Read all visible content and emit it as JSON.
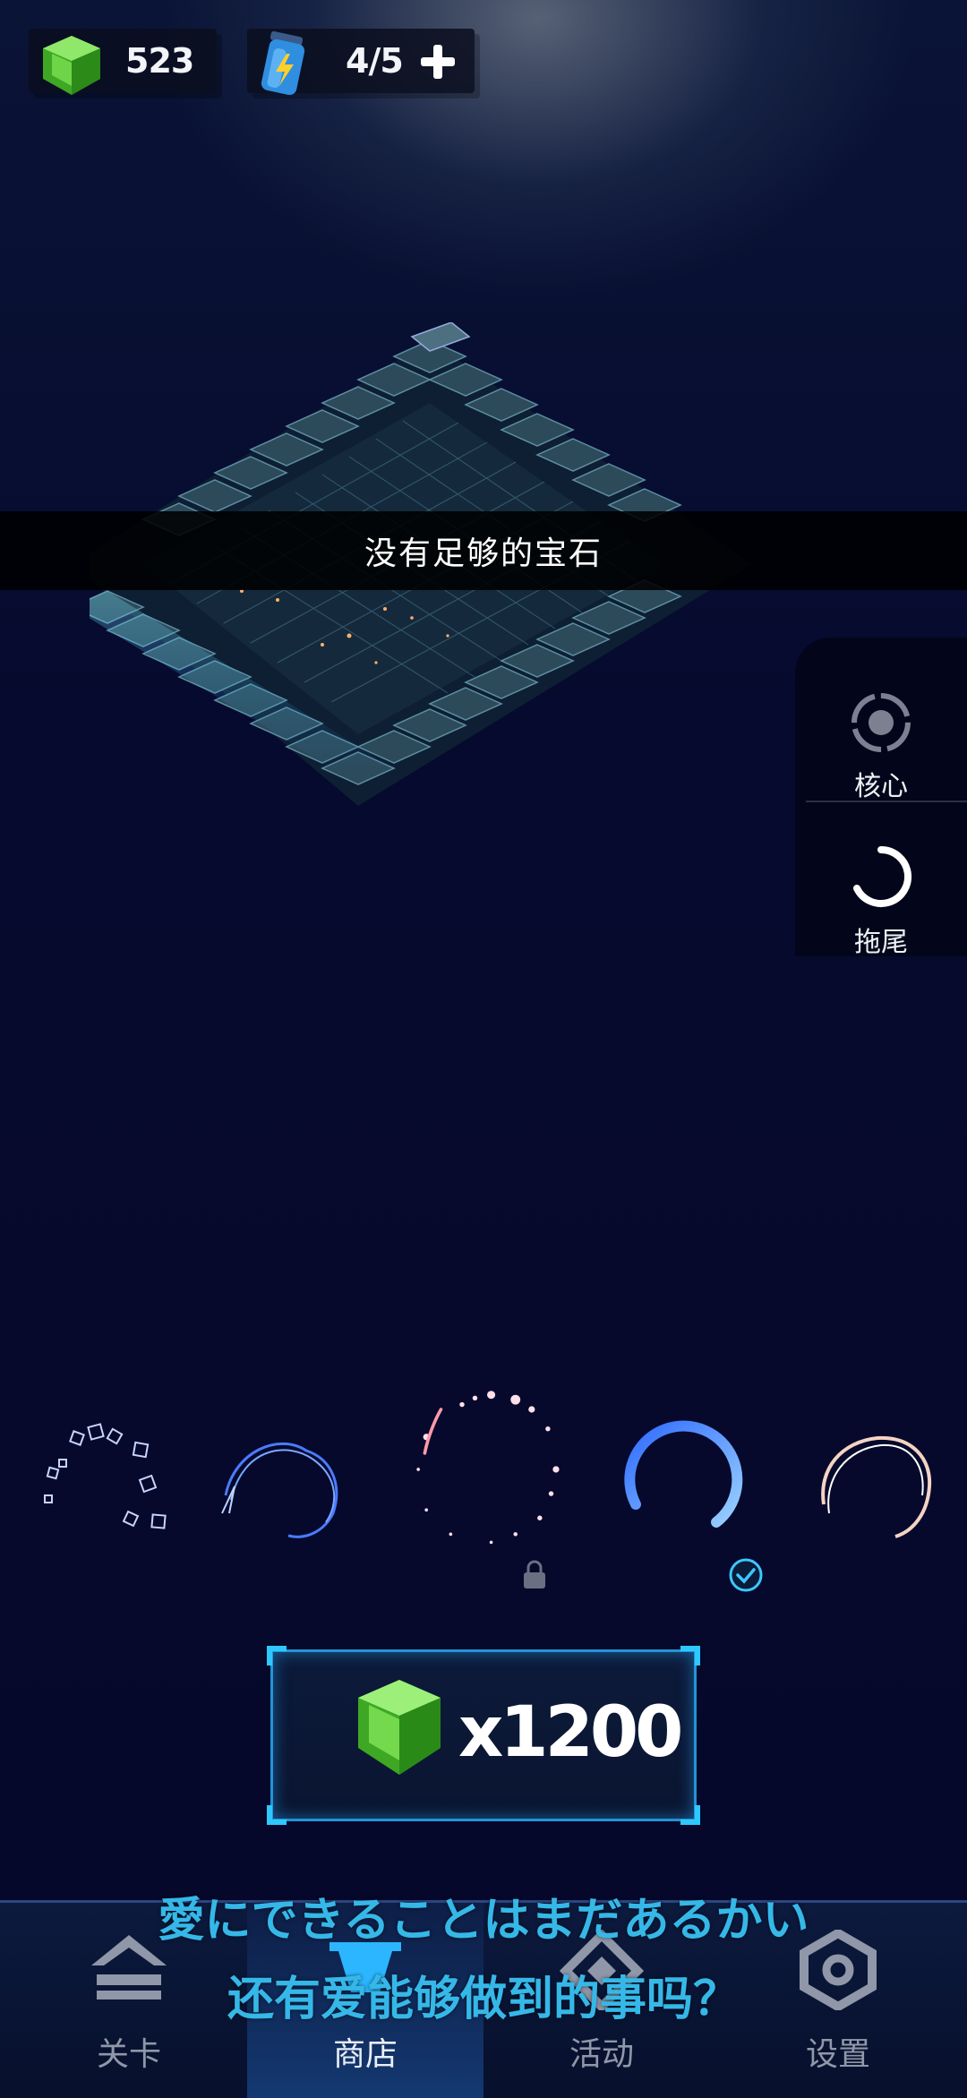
{
  "hud": {
    "gems": "523",
    "energy": "4/5"
  },
  "toast": "没有足够的宝石",
  "side_panel": {
    "core_label": "核心",
    "trail_label": "拖尾"
  },
  "shop": {
    "price": "x1200"
  },
  "tabs": [
    {
      "label": "关卡"
    },
    {
      "label": "商店"
    },
    {
      "label": "活动"
    },
    {
      "label": "设置"
    }
  ],
  "lyrics": {
    "line1": "愛にできることはまだあるかい",
    "line2": "还有爱能够做到的事吗？"
  },
  "colors": {
    "accent": "#2ec8ff",
    "gem": "#5fd23a",
    "lyric": "#35b8e8"
  }
}
